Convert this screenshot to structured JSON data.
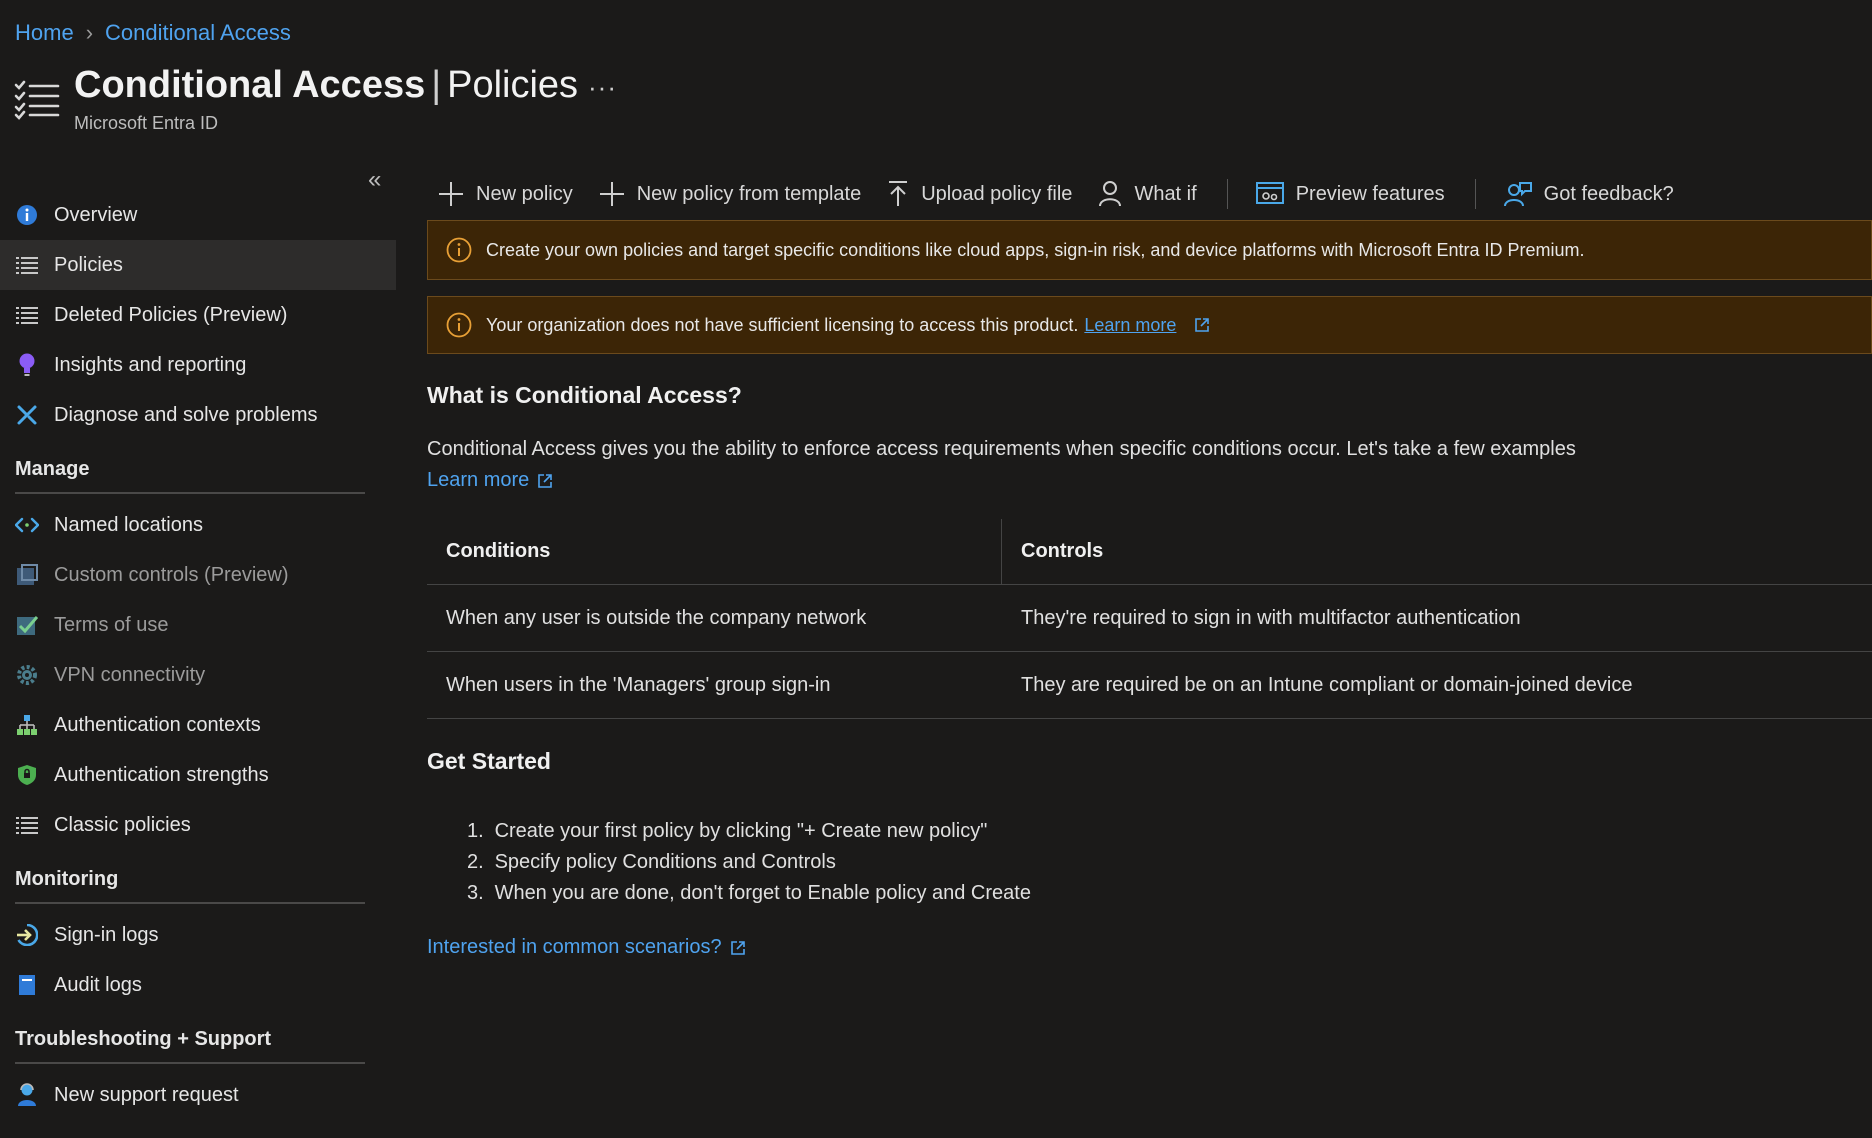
{
  "breadcrumb": {
    "home": "Home",
    "current": "Conditional Access"
  },
  "header": {
    "title": "Conditional Access",
    "separator": "|",
    "section": "Policies",
    "more": "···",
    "subtitle": "Microsoft Entra ID"
  },
  "sidebar": {
    "collapse": "«",
    "top_items": [
      {
        "label": "Overview",
        "icon": "info-icon"
      },
      {
        "label": "Policies",
        "icon": "list-icon",
        "active": true
      },
      {
        "label": "Deleted Policies (Preview)",
        "icon": "list-icon"
      },
      {
        "label": "Insights and reporting",
        "icon": "lightbulb-icon"
      },
      {
        "label": "Diagnose and solve problems",
        "icon": "wrench-icon"
      }
    ],
    "manage_title": "Manage",
    "manage_items": [
      {
        "label": "Named locations",
        "icon": "code-arrows-icon"
      },
      {
        "label": "Custom controls (Preview)",
        "icon": "custom-controls-icon"
      },
      {
        "label": "Terms of use",
        "icon": "checkbox-icon"
      },
      {
        "label": "VPN connectivity",
        "icon": "gear-icon"
      },
      {
        "label": "Authentication contexts",
        "icon": "hierarchy-icon"
      },
      {
        "label": "Authentication strengths",
        "icon": "shield-icon"
      },
      {
        "label": "Classic policies",
        "icon": "list-icon"
      }
    ],
    "monitoring_title": "Monitoring",
    "monitoring_items": [
      {
        "label": "Sign-in logs",
        "icon": "sign-in-icon"
      },
      {
        "label": "Audit logs",
        "icon": "book-icon"
      }
    ],
    "support_title": "Troubleshooting + Support",
    "support_items": [
      {
        "label": "New support request",
        "icon": "person-support-icon"
      }
    ]
  },
  "toolbar": {
    "new_policy": "New policy",
    "new_from_template": "New policy from template",
    "upload": "Upload policy file",
    "what_if": "What if",
    "preview": "Preview features",
    "feedback": "Got feedback?"
  },
  "banners": {
    "premium": "Create your own policies and target specific conditions like cloud apps, sign-in risk, and device platforms with Microsoft Entra ID Premium.",
    "license": "Your organization does not have sufficient licensing to access this product.",
    "license_link": "Learn more"
  },
  "what": {
    "heading": "What is Conditional Access?",
    "description": "Conditional Access gives you the ability to enforce access requirements when specific conditions occur. Let's take a few examples",
    "learn_more": "Learn more"
  },
  "table": {
    "headers": [
      "Conditions",
      "Controls"
    ],
    "rows": [
      [
        "When any user is outside the company network",
        "They're required to sign in with multifactor authentication"
      ],
      [
        "When users in the 'Managers' group sign-in",
        "They are required be on an Intune compliant or domain-joined device"
      ]
    ]
  },
  "get_started": {
    "heading": "Get Started",
    "steps": [
      {
        "num": "1.",
        "text": "Create your first policy by clicking \"+ Create new policy\""
      },
      {
        "num": "2.",
        "text": "Specify policy Conditions and Controls"
      },
      {
        "num": "3.",
        "text": "When you are done, don't forget to Enable policy and Create"
      }
    ],
    "scenarios_link": "Interested in common scenarios?"
  },
  "colors": {
    "background": "#1b1a19",
    "link": "#4fa3ef",
    "banner_bg": "#3c2506",
    "warning": "#e8a036"
  }
}
